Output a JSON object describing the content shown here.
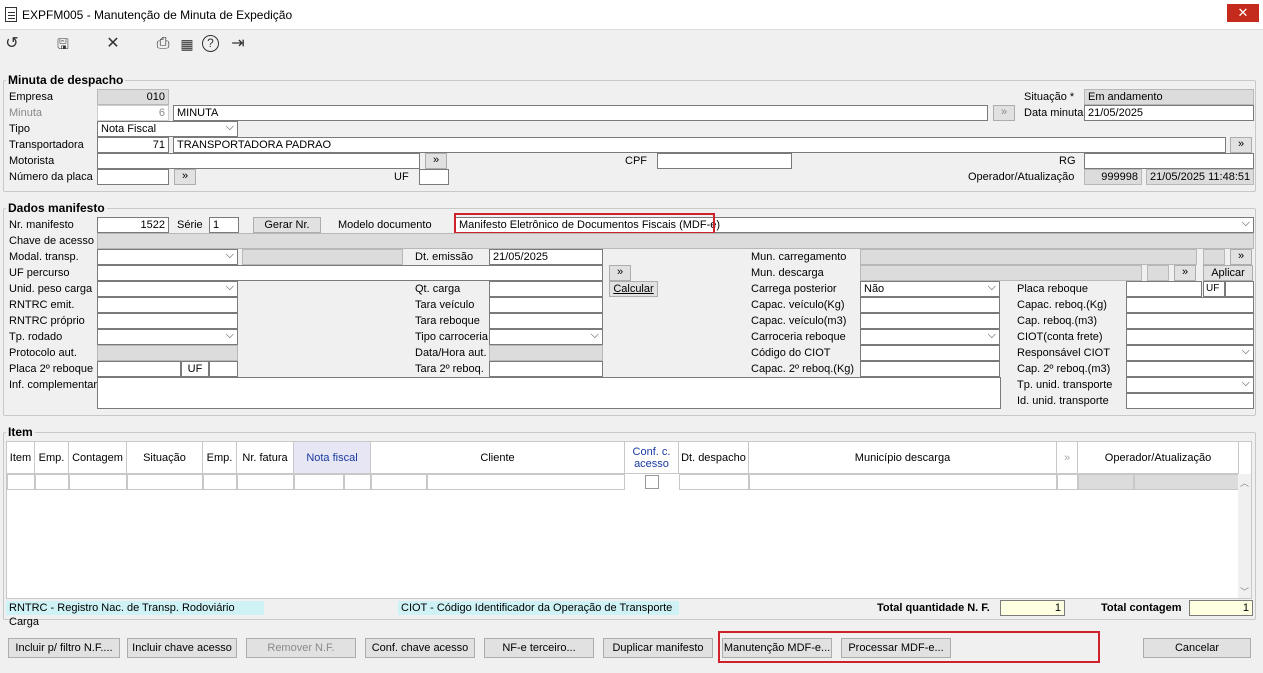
{
  "window": {
    "title": "EXPFM005 - Manutenção de Minuta de Expedição",
    "close": "✕"
  },
  "toolbar": {
    "icons": [
      "undo-icon",
      "save-icon",
      "cancel-icon",
      "print-icon",
      "calendar-icon",
      "help-icon",
      "exit-icon"
    ],
    "glyphs": {
      "undo": "↺",
      "save": "🖫",
      "cancel": "✕",
      "print": "⎙",
      "calendar": "▦",
      "help": "?",
      "exit": "⇥"
    }
  },
  "minuta": {
    "legend": "Minuta de despacho",
    "empresa_label": "Empresa",
    "empresa": "010",
    "minuta_label": "Minuta",
    "minuta_num": "6",
    "minuta_desc": "MINUTA",
    "tipo_label": "Tipo",
    "tipo": "Nota Fiscal",
    "transp_label": "Transportadora",
    "transp_code": "71",
    "transp_name": "TRANSPORTADORA PADRAO",
    "motorista_label": "Motorista",
    "motorista": "",
    "placa_label": "Número da placa",
    "placa": "",
    "uf_label": "UF",
    "uf": "",
    "cpf_label": "CPF",
    "cpf": "",
    "rg_label": "RG",
    "rg": "",
    "situacao_label": "Situação *",
    "situacao": "Em andamento",
    "data_label": "Data minuta",
    "data": "21/05/2025",
    "operador_label": "Operador/Atualização",
    "operador": "999998",
    "atualizacao": "21/05/2025 11:48:51"
  },
  "manifesto": {
    "legend": "Dados manifesto",
    "nr_label": "Nr. manifesto",
    "nr": "1522",
    "serie_label": "Série",
    "serie": "1",
    "gerar": "Gerar Nr.",
    "modelo_label": "Modelo documento",
    "modelo": "Manifesto Eletrônico de Documentos Fiscais (MDF-e)",
    "chave_label": "Chave de acesso",
    "modal_label": "Modal. transp.",
    "dt_emissao_label": "Dt. emissão",
    "dt_emissao": "21/05/2025",
    "mun_carreg_label": "Mun. carregamento",
    "uf_percurso_label": "UF percurso",
    "mun_desc_label": "Mun. descarga",
    "aplicar": "Aplicar",
    "unid_peso_label": "Unid. peso carga",
    "qt_carga_label": "Qt. carga",
    "calcular": "Calcular",
    "carrega_post_label": "Carrega posterior",
    "carrega_post": "Não",
    "placa_reboque_label": "Placa reboque",
    "uf_small": "UF",
    "rntrc_emit_label": "RNTRC emit.",
    "tara_veic_label": "Tara veículo",
    "capac_veic_kg_label": "Capac. veículo(Kg)",
    "capac_reboq_kg_label": "Capac. reboq.(Kg)",
    "rntrc_prop_label": "RNTRC próprio",
    "tara_reboque_label": "Tara reboque",
    "capac_veic_m3_label": "Capac. veículo(m3)",
    "cap_reboq_m3_label": "Cap. reboq.(m3)",
    "tp_rodado_label": "Tp. rodado",
    "tipo_carroc_label": "Tipo carroceria",
    "carroc_reboque_label": "Carroceria reboque",
    "ciot_frete_label": "CIOT(conta frete)",
    "protocolo_label": "Protocolo aut.",
    "data_hora_label": "Data/Hora aut.",
    "codigo_ciot_label": "Código do CIOT",
    "resp_ciot_label": "Responsável CIOT",
    "placa2_label": "Placa 2º reboque",
    "tara2_label": "Tara 2º reboq.",
    "capac2_label": "Capac. 2º reboq.(Kg)",
    "cap2_m3_label": "Cap. 2º reboq.(m3)",
    "inf_comp_label": "Inf. complementar",
    "tp_unid_label": "Tp. unid. transporte",
    "id_unid_label": "Id. unid. transporte"
  },
  "item": {
    "legend": "Item",
    "columns": [
      "Item",
      "Emp.",
      "Contagem",
      "Situação",
      "Emp.",
      "Nr. fatura",
      "Nota fiscal",
      "Cliente",
      "Conf. c. acesso",
      "Dt. despacho",
      "Município descarga",
      "Operador/Atualização"
    ],
    "rntrc_note": "RNTRC - Registro Nac. de Transp. Rodoviário Carga",
    "ciot_note": "CIOT - Código Identificador da Operação de Transporte",
    "total_nf_label": "Total quantidade N. F.",
    "total_nf": "1",
    "total_cont_label": "Total contagem",
    "total_cont": "1"
  },
  "buttons": {
    "incluir_filtro": "Incluir p/ filtro N.F....",
    "incluir_chave": "Incluir chave acesso",
    "remover": "Remover N.F.",
    "conf_chave": "Conf. chave acesso",
    "nfe_terceiro": "NF-e terceiro...",
    "duplicar": "Duplicar manifesto",
    "manut_mdfe": "Manutenção MDF-e...",
    "processar_mdfe": "Processar MDF-e...",
    "cancelar": "Cancelar"
  },
  "lookup": "»",
  "colors": {
    "highlight": "#d0202a",
    "readonly": "#dcdcdc",
    "note_bg": "#cef2f5",
    "total_bg": "#ffffe1",
    "close": "#c42b1c"
  }
}
